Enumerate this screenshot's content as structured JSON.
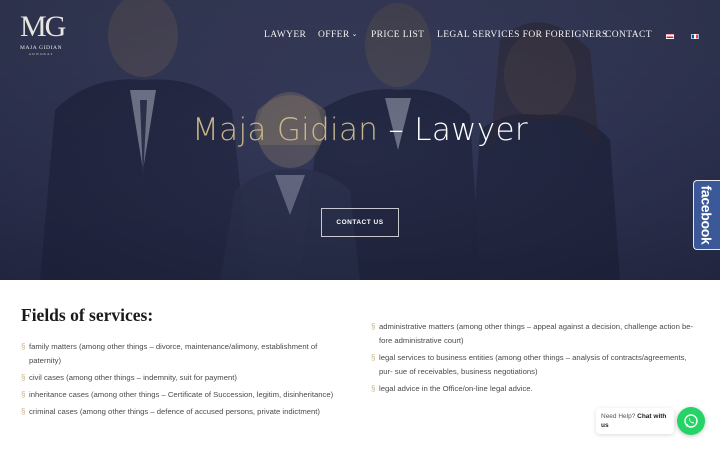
{
  "logo": {
    "mark": "MG",
    "name": "MAJA GIDIAN",
    "sub": "ADWOKAT"
  },
  "nav": {
    "items": [
      {
        "label": "LAWYER"
      },
      {
        "label": "OFFER"
      },
      {
        "label": "PRICE LIST"
      },
      {
        "label": "LEGAL SERVICES FOR FOREIGNERS"
      },
      {
        "label": "CONTACT"
      }
    ],
    "languages": [
      "pl-flag",
      "fr-flag"
    ]
  },
  "hero": {
    "title_name": "Maja Gidian",
    "title_rest": " – Lawyer",
    "button": "CONTACT US",
    "accent_color": "#c8b58a"
  },
  "social": {
    "facebook_label": "facebook",
    "facebook_color": "#3b5998"
  },
  "services": {
    "title": "Fields of services:",
    "left": [
      "family matters (among other things – divorce, maintenance/alimony, establishment of paternity)",
      "civil cases (among other things – indemnity, suit for payment)",
      "inheritance cases (among other things – Certificate of Succession, legitim, disinheritance)",
      "criminal cases (among other things – defence of accused persons, private indictment)"
    ],
    "right": [
      "administrative matters (among other things – appeal against a decision, challenge action be- fore administrative court)",
      "legal services to business entities (among other things – analysis of contracts/agreements, pur- sue of receivables, business negotiations)",
      "legal advice in the Office/on-line legal advice."
    ],
    "bullet": "§"
  },
  "chat": {
    "prefix": "Need Help?",
    "bold": "Chat with us",
    "icon": "whatsapp-icon",
    "color": "#25d366"
  }
}
